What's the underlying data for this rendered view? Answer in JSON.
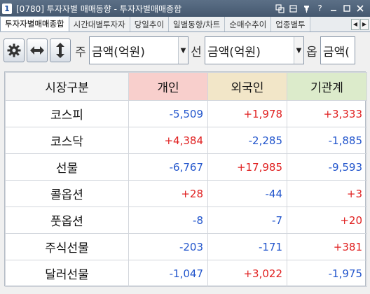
{
  "window": {
    "number": "1",
    "title": "[0780] 투자자별 매매동향 - 투자자별매매종합"
  },
  "tabs": [
    {
      "label": "투자자별매매종합",
      "active": true
    },
    {
      "label": "시간대별투자자"
    },
    {
      "label": "당일추이"
    },
    {
      "label": "일별동향/차트"
    },
    {
      "label": "순매수추이"
    },
    {
      "label": "업종별투"
    }
  ],
  "toolbar": {
    "label1": "주",
    "select1_value": "금액(억원)",
    "label2": "선",
    "select2_value": "금액(억원)",
    "label3": "옵",
    "select3_value": "금액("
  },
  "grid": {
    "headers": [
      "시장구분",
      "개인",
      "외국인",
      "기관계"
    ],
    "rows": [
      {
        "market": "코스피",
        "individual": "-5,509",
        "foreign": "+1,978",
        "institution": "+3,333"
      },
      {
        "market": "코스닥",
        "individual": "+4,384",
        "foreign": "-2,285",
        "institution": "-1,885"
      },
      {
        "market": "선물",
        "individual": "-6,767",
        "foreign": "+17,985",
        "institution": "-9,593"
      },
      {
        "market": "콜옵션",
        "individual": "+28",
        "foreign": "-44",
        "institution": "+3"
      },
      {
        "market": "풋옵션",
        "individual": "-8",
        "foreign": "-7",
        "institution": "+20"
      },
      {
        "market": "주식선물",
        "individual": "-203",
        "foreign": "-171",
        "institution": "+381"
      },
      {
        "market": "달러선물",
        "individual": "-1,047",
        "foreign": "+3,022",
        "institution": "-1,975"
      }
    ]
  },
  "colors": {
    "negative": "#2255cc",
    "positive": "#e02020",
    "header_individual": "#f8cfcc",
    "header_foreign": "#f2e6c8",
    "header_institution": "#dcebcb"
  }
}
